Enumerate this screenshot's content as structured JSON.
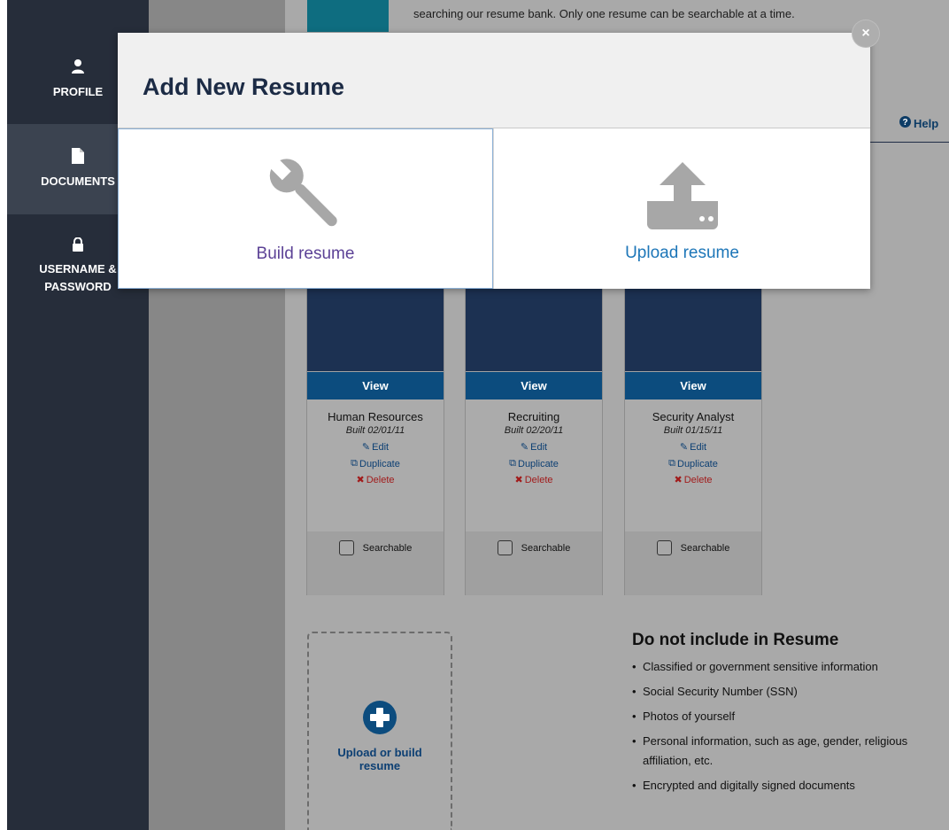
{
  "sidebar": {
    "items": [
      {
        "label": "PROFILE",
        "icon": "user-icon"
      },
      {
        "label": "DOCUMENTS",
        "icon": "document-icon",
        "active": true
      },
      {
        "label_line1": "USERNAME &",
        "label_line2": "PASSWORD",
        "icon": "lock-icon"
      }
    ]
  },
  "page": {
    "notice": "searching our resume bank. Only one resume can be searchable at a time.",
    "help_label": "Help"
  },
  "resumes": [
    {
      "view_label": "View",
      "title": "Human Resources",
      "built": "Built 02/01/11",
      "edit_label": "Edit",
      "duplicate_label": "Duplicate",
      "delete_label": "Delete",
      "searchable_label": "Searchable",
      "searchable": false
    },
    {
      "view_label": "View",
      "title": "Recruiting",
      "built": "Built 02/20/11",
      "edit_label": "Edit",
      "duplicate_label": "Duplicate",
      "delete_label": "Delete",
      "searchable_label": "Searchable",
      "searchable": false
    },
    {
      "view_label": "View",
      "title": "Security Analyst",
      "built": "Built 01/15/11",
      "edit_label": "Edit",
      "duplicate_label": "Duplicate",
      "delete_label": "Delete",
      "searchable_label": "Searchable",
      "searchable": false
    }
  ],
  "upload_tile": {
    "label": "Upload or build resume"
  },
  "do_not_include": {
    "heading": "Do not include in Resume",
    "items": [
      "Classified or government sensitive information",
      "Social Security Number (SSN)",
      "Photos of yourself",
      "Personal information, such as age, gender, religious affiliation, etc.",
      "Encrypted and digitally signed documents"
    ]
  },
  "modal": {
    "title": "Add New Resume",
    "close_glyph": "×",
    "options": [
      {
        "label": "Build resume",
        "icon": "wrench-icon"
      },
      {
        "label": "Upload resume",
        "icon": "upload-icon"
      }
    ]
  },
  "colors": {
    "sidebar": "#262d3a",
    "card_thumb": "#1c3152",
    "view_button": "#0c4c7e",
    "link": "#0c3f73",
    "delete": "#a11b1b",
    "build_label": "#5c4296",
    "upload_label": "#1d76b8"
  }
}
